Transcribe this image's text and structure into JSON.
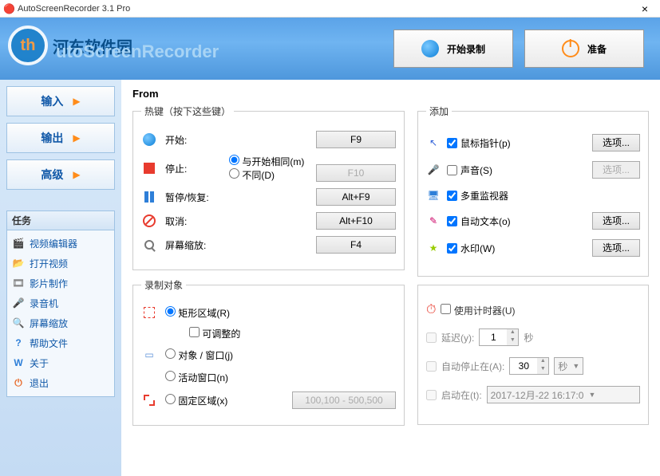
{
  "titlebar": {
    "title": "AutoScreenRecorder 3.1 Pro",
    "close": "×"
  },
  "watermark": {
    "cn": "河东软件园",
    "brand": "utoScreenRecorder"
  },
  "header": {
    "start": "开始录制",
    "ready": "准备"
  },
  "sidebar": {
    "nav": [
      "输入",
      "输出",
      "高级"
    ],
    "tasks_title": "任务",
    "tasks": [
      {
        "icon": "🎬",
        "color": "#2e7fd8",
        "label": "视频编辑器"
      },
      {
        "icon": "📂",
        "color": "#d8a02e",
        "label": "打开视频"
      },
      {
        "icon": "🎞",
        "color": "#888",
        "label": "影片制作"
      },
      {
        "icon": "🎤",
        "color": "#888",
        "label": "录音机"
      },
      {
        "icon": "🔍",
        "color": "#2e7fd8",
        "label": "屏幕缩放"
      },
      {
        "icon": "?",
        "color": "#2e7fd8",
        "label": "帮助文件"
      },
      {
        "icon": "W",
        "color": "#2e7fd8",
        "label": "关于"
      },
      {
        "icon": "⏻",
        "color": "#e86d2e",
        "label": "退出"
      }
    ]
  },
  "main": {
    "section": "From",
    "hotkeys": {
      "legend": "热键（按下这些键）",
      "start": "开始:",
      "start_key": "F9",
      "stop": "停止:",
      "stop_same": "与开始相同(m)",
      "stop_diff": "不同(D)",
      "stop_key": "F10",
      "pause": "暂停/恢复:",
      "pause_key": "Alt+F9",
      "cancel": "取消:",
      "cancel_key": "Alt+F10",
      "zoom": "屏幕缩放:",
      "zoom_key": "F4"
    },
    "target": {
      "legend": "录制对象",
      "rect": "矩形区域(R)",
      "adjustable": "可调整的",
      "obj": "对象 / 窗口(j)",
      "active": "活动窗口(n)",
      "fixed": "固定区域(x)",
      "fixed_val": "100,100 - 500,500"
    },
    "add": {
      "legend": "添加",
      "pointer": "鼠标指针(p)",
      "opt": "选项...",
      "sound": "声音(S)",
      "multi": "多重监视器",
      "autotext": "自动文本(o)",
      "watermark": "水印(W)"
    },
    "timer": {
      "use": "使用计时器(U)",
      "delay": "延迟(y):",
      "delay_val": "1",
      "sec": "秒",
      "autostop": "自动停止在(A):",
      "autostop_val": "30",
      "autostop_unit": "秒",
      "starton": "启动在(t):",
      "starton_val": "2017-12月-22 16:17:0"
    }
  }
}
